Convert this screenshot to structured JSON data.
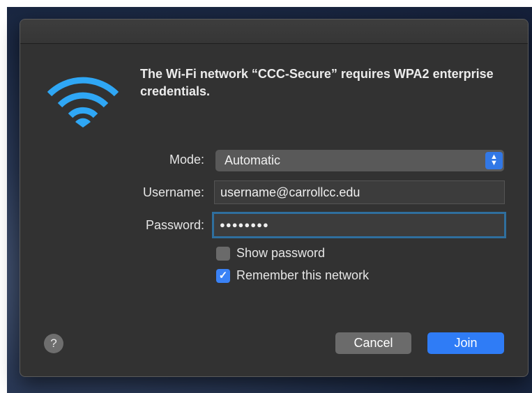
{
  "dialog": {
    "message": "The Wi-Fi network “CCC-Secure” requires WPA2 enterprise credentials.",
    "icon": "wifi-icon",
    "accent_color": "#2fa7f5"
  },
  "form": {
    "mode_label": "Mode:",
    "mode_value": "Automatic",
    "username_label": "Username:",
    "username_value": "username@carrollcc.edu",
    "password_label": "Password:",
    "password_value": "●●●●●●●●",
    "show_password_label": "Show password",
    "show_password_checked": false,
    "remember_label": "Remember this network",
    "remember_checked": true
  },
  "buttons": {
    "help": "?",
    "cancel": "Cancel",
    "join": "Join"
  }
}
